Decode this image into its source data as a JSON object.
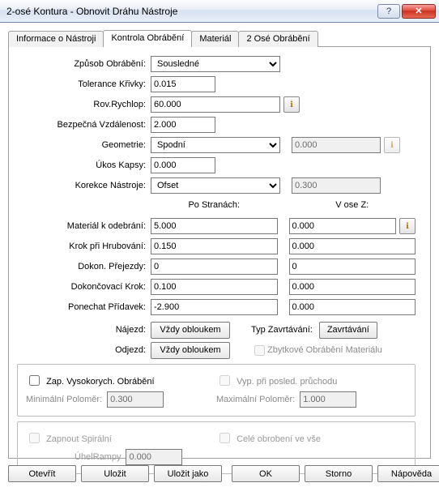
{
  "window": {
    "title": "2-osé Kontura - Obnovit Dráhu Nástroje"
  },
  "tabs": [
    "Informace o Nástroji",
    "Kontrola Obrábění",
    "Materiál",
    "2 Osé Obrábění"
  ],
  "activeTab": 1,
  "labels": {
    "zpusob": "Způsob Obrábění:",
    "tolerance": "Tolerance Křivky:",
    "rychlop": "Rov.Rychlop:",
    "bezpecna": "Bezpečná Vzdálenost:",
    "geometrie": "Geometrie:",
    "ukos": "Úkos Kapsy:",
    "korekce": "Korekce Nástroje:",
    "poStranach": "Po Stranách:",
    "voseZ": "V ose Z:",
    "material": "Materiál k odebrání:",
    "krokHrub": "Krok při Hrubování:",
    "dokonPrejezdy": "Dokon. Přejezdy:",
    "dokonKrok": "Dokončovací Krok:",
    "ponechat": "Ponechat Přídavek:",
    "najezd": "Nájezd:",
    "odjezd": "Odjezd:",
    "typZavr": "Typ Zavrtávání:",
    "zbytkove": "Zbytkové Obrábění Materiálu",
    "zapVysoko": "Zap. Vysokorych. Obrábění",
    "vypPosled": "Vyp. při posled. průchodu",
    "minPolomer": "Minimální Poloměr:",
    "maxPolomer": "Maximální Poloměr:",
    "zapSpiral": "Zapnout Spirální",
    "uhelRampy": "ÚhelRampy",
    "celeObrob": "Celé obrobení ve vše"
  },
  "values": {
    "zpusob": "Sousledné",
    "tolerance": "0.015",
    "rychlop": "60.000",
    "bezpecna": "2.000",
    "geometrie": "Spodní",
    "geometrieNum": "0.000",
    "ukos": "0.000",
    "korekce": "Ofset",
    "korekceNum": "0.300",
    "poMaterial": "5.000",
    "zMaterial": "0.000",
    "poKrokHrub": "0.150",
    "zKrokHrub": "0.000",
    "poDokonPrejezdy": "0",
    "zDokonPrejezdy": "0",
    "poDokonKrok": "0.100",
    "zDokonKrok": "0.000",
    "poPonechat": "-2.900",
    "zPonechat": "0.000",
    "minPolomer": "0.300",
    "maxPolomer": "1.000",
    "uhelRampy": "0.000"
  },
  "buttons": {
    "najezd": "Vždy obloukem",
    "odjezd": "Vždy obloukem",
    "zavrtavani": "Zavrtávání",
    "otevrit": "Otevřít",
    "ulozit": "Uložit",
    "ulozitJako": "Uložit jako",
    "ok": "OK",
    "storno": "Storno",
    "napoveda": "Nápověda"
  }
}
